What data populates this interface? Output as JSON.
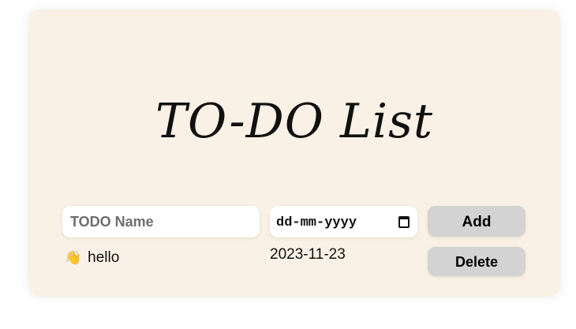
{
  "app": {
    "title": "TO-DO List"
  },
  "form": {
    "name_placeholder": "TODO Name",
    "name_value": "",
    "date_placeholder": "dd-mm-yyyy",
    "add_label": "Add"
  },
  "todos": [
    {
      "emoji": "👋",
      "name": "hello",
      "date": "2023-11-23",
      "delete_label": "Delete"
    }
  ],
  "icons": {
    "calendar": "calendar-icon",
    "wave": "waving-hand-icon"
  },
  "colors": {
    "card_background": "#faf1e6",
    "button_background": "#d3d3d3",
    "input_background": "#ffffff"
  }
}
